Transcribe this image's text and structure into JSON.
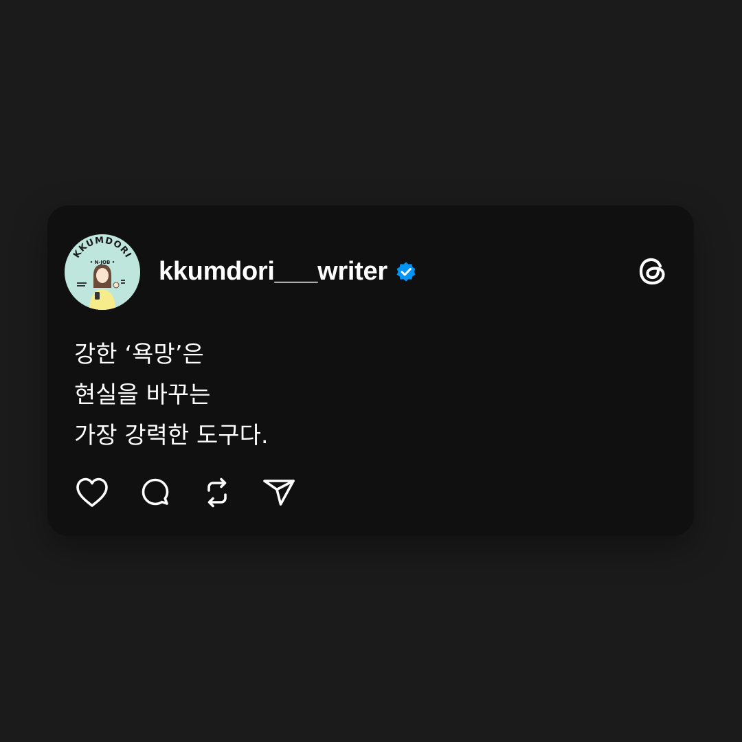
{
  "post": {
    "username": "kkumdori___writer",
    "verified": true,
    "avatar": {
      "title_text": "KKUMDORI",
      "subtitle_text": "• N-JOB •",
      "background_color": "#bfe6dc"
    },
    "lines": [
      "강한 ‘욕망’은",
      "현실을 바꾸는",
      "가장 강력한 도구다."
    ]
  },
  "icons": {
    "verified": "verified-badge-icon",
    "threads": "threads-logo-icon",
    "like": "heart-icon",
    "comment": "comment-bubble-icon",
    "repost": "repost-icon",
    "share": "send-icon"
  },
  "colors": {
    "page_background": "#1b1b1b",
    "card_background": "#101010",
    "text": "#ffffff",
    "verified_blue": "#0095f6"
  }
}
